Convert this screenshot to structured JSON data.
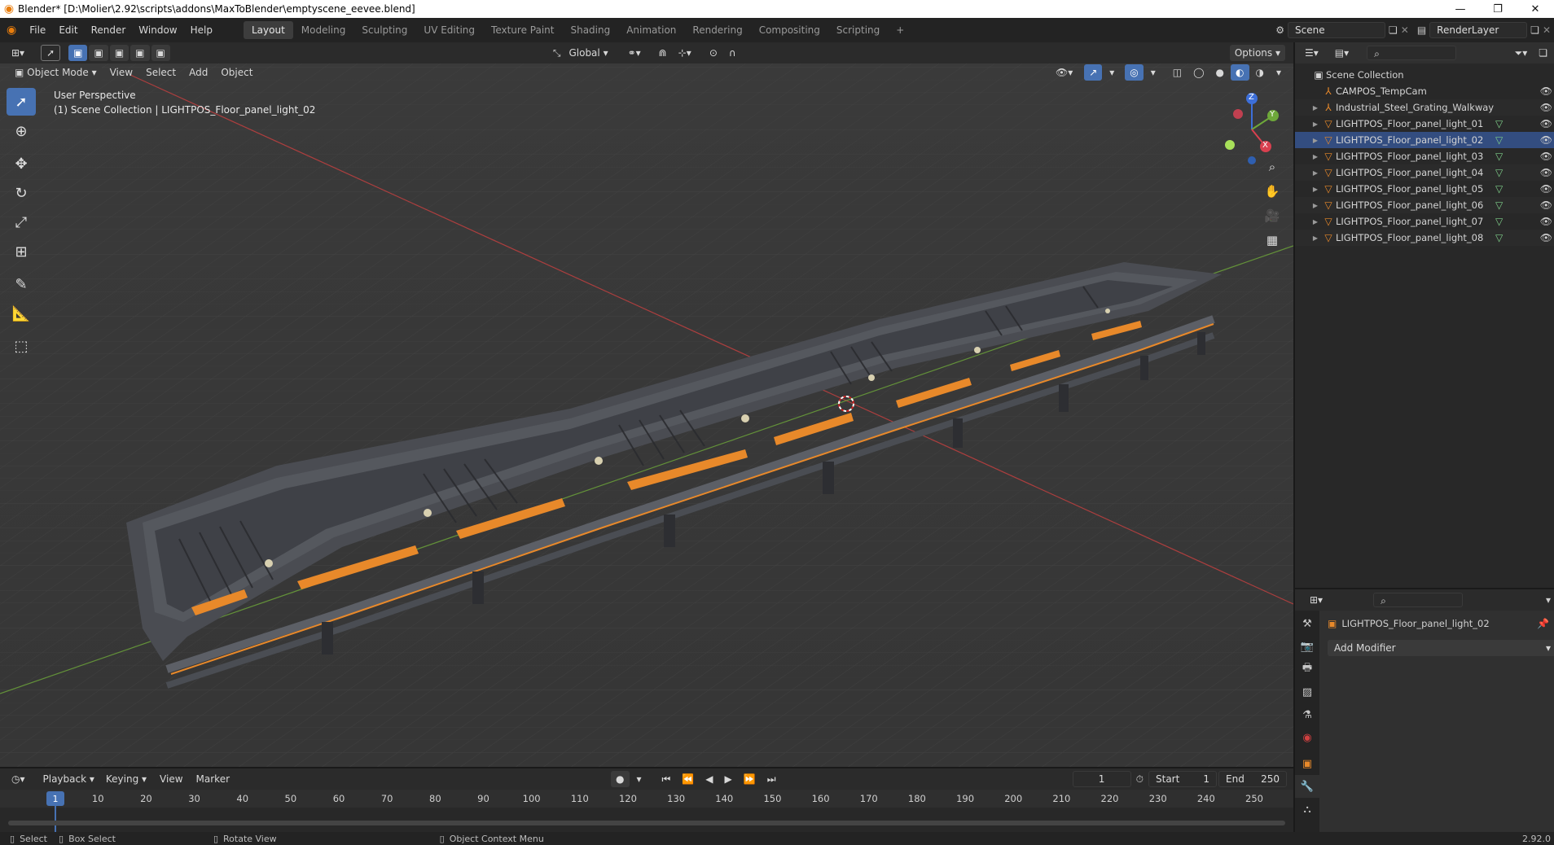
{
  "window": {
    "title": "Blender* [D:\\Molier\\2.92\\scripts\\addons\\MaxToBlender\\emptyscene_eevee.blend]",
    "minimize": "—",
    "restore": "❐",
    "close": "✕"
  },
  "menu": [
    "File",
    "Edit",
    "Render",
    "Window",
    "Help"
  ],
  "workspaces": [
    "Layout",
    "Modeling",
    "Sculpting",
    "UV Editing",
    "Texture Paint",
    "Shading",
    "Animation",
    "Rendering",
    "Compositing",
    "Scripting"
  ],
  "add_workspace": "+",
  "scene": {
    "name": "Scene",
    "render_layer": "RenderLayer"
  },
  "viewport_header": {
    "transform_orientation": "Global",
    "options": "Options",
    "mode": "Object Mode",
    "menus": [
      "View",
      "Select",
      "Add",
      "Object"
    ]
  },
  "viewport": {
    "perspective": "User Perspective",
    "collection_info": "(1) Scene Collection | LIGHTPOS_Floor_panel_light_02",
    "gizmo": {
      "z": "Z",
      "y": "Y",
      "x": "X"
    }
  },
  "outliner": {
    "root": "Scene Collection",
    "items": [
      {
        "name": "CAMPOS_TempCam",
        "icon": "empty-icon",
        "expand": false
      },
      {
        "name": "Industrial_Steel_Grating_Walkway",
        "icon": "empty-icon",
        "expand": true
      },
      {
        "name": "LIGHTPOS_Floor_panel_light_01",
        "icon": "mesh-object-icon",
        "expand": true
      },
      {
        "name": "LIGHTPOS_Floor_panel_light_02",
        "icon": "mesh-object-icon",
        "expand": true
      },
      {
        "name": "LIGHTPOS_Floor_panel_light_03",
        "icon": "mesh-object-icon",
        "expand": true
      },
      {
        "name": "LIGHTPOS_Floor_panel_light_04",
        "icon": "mesh-object-icon",
        "expand": true
      },
      {
        "name": "LIGHTPOS_Floor_panel_light_05",
        "icon": "mesh-object-icon",
        "expand": true
      },
      {
        "name": "LIGHTPOS_Floor_panel_light_06",
        "icon": "mesh-object-icon",
        "expand": true
      },
      {
        "name": "LIGHTPOS_Floor_panel_light_07",
        "icon": "mesh-object-icon",
        "expand": true
      },
      {
        "name": "LIGHTPOS_Floor_panel_light_08",
        "icon": "mesh-object-icon",
        "expand": true
      }
    ]
  },
  "properties": {
    "object_name": "LIGHTPOS_Floor_panel_light_02",
    "add_modifier": "Add Modifier"
  },
  "timeline": {
    "menus": [
      "Playback",
      "Keying",
      "View",
      "Marker"
    ],
    "current_frame": "1",
    "start_label": "Start",
    "start": "1",
    "end_label": "End",
    "end": "250",
    "ticks": [
      "1",
      "10",
      "20",
      "30",
      "40",
      "50",
      "60",
      "70",
      "80",
      "90",
      "100",
      "110",
      "120",
      "130",
      "140",
      "150",
      "160",
      "170",
      "180",
      "190",
      "200",
      "210",
      "220",
      "230",
      "240",
      "250"
    ]
  },
  "status": {
    "select": "Select",
    "box_select": "Box Select",
    "rotate_view": "Rotate View",
    "context_menu": "Object Context Menu",
    "version": "2.92.0"
  },
  "colors": {
    "accent": "#4772b3",
    "orange_light": "#e8892a",
    "x_axis": "#c94040",
    "y_axis": "#6ea83a"
  }
}
